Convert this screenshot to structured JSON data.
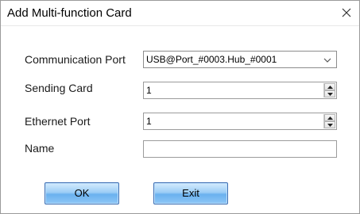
{
  "dialog": {
    "title": "Add Multi-function Card",
    "close_glyph": "close-icon"
  },
  "form": {
    "communication_port": {
      "label": "Communication Port",
      "value": "USB@Port_#0003.Hub_#0001"
    },
    "sending_card": {
      "label": "Sending Card",
      "value": "1"
    },
    "ethernet_port": {
      "label": "Ethernet Port",
      "value": "1"
    },
    "name": {
      "label": "Name",
      "value": ""
    }
  },
  "buttons": {
    "ok_label": "OK",
    "exit_label": "Exit"
  },
  "colors": {
    "button_accent": "#6ab1ef",
    "button_border": "#3e6fb3"
  }
}
